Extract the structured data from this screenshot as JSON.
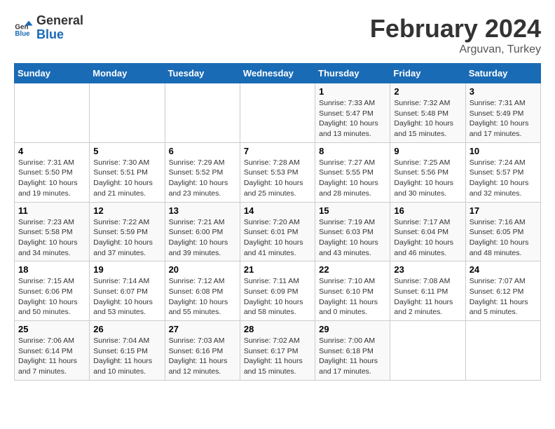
{
  "logo": {
    "general": "General",
    "blue": "Blue"
  },
  "title": "February 2024",
  "subtitle": "Arguvan, Turkey",
  "headers": [
    "Sunday",
    "Monday",
    "Tuesday",
    "Wednesday",
    "Thursday",
    "Friday",
    "Saturday"
  ],
  "weeks": [
    [
      {
        "day": "",
        "info": ""
      },
      {
        "day": "",
        "info": ""
      },
      {
        "day": "",
        "info": ""
      },
      {
        "day": "",
        "info": ""
      },
      {
        "day": "1",
        "info": "Sunrise: 7:33 AM\nSunset: 5:47 PM\nDaylight: 10 hours\nand 13 minutes."
      },
      {
        "day": "2",
        "info": "Sunrise: 7:32 AM\nSunset: 5:48 PM\nDaylight: 10 hours\nand 15 minutes."
      },
      {
        "day": "3",
        "info": "Sunrise: 7:31 AM\nSunset: 5:49 PM\nDaylight: 10 hours\nand 17 minutes."
      }
    ],
    [
      {
        "day": "4",
        "info": "Sunrise: 7:31 AM\nSunset: 5:50 PM\nDaylight: 10 hours\nand 19 minutes."
      },
      {
        "day": "5",
        "info": "Sunrise: 7:30 AM\nSunset: 5:51 PM\nDaylight: 10 hours\nand 21 minutes."
      },
      {
        "day": "6",
        "info": "Sunrise: 7:29 AM\nSunset: 5:52 PM\nDaylight: 10 hours\nand 23 minutes."
      },
      {
        "day": "7",
        "info": "Sunrise: 7:28 AM\nSunset: 5:53 PM\nDaylight: 10 hours\nand 25 minutes."
      },
      {
        "day": "8",
        "info": "Sunrise: 7:27 AM\nSunset: 5:55 PM\nDaylight: 10 hours\nand 28 minutes."
      },
      {
        "day": "9",
        "info": "Sunrise: 7:25 AM\nSunset: 5:56 PM\nDaylight: 10 hours\nand 30 minutes."
      },
      {
        "day": "10",
        "info": "Sunrise: 7:24 AM\nSunset: 5:57 PM\nDaylight: 10 hours\nand 32 minutes."
      }
    ],
    [
      {
        "day": "11",
        "info": "Sunrise: 7:23 AM\nSunset: 5:58 PM\nDaylight: 10 hours\nand 34 minutes."
      },
      {
        "day": "12",
        "info": "Sunrise: 7:22 AM\nSunset: 5:59 PM\nDaylight: 10 hours\nand 37 minutes."
      },
      {
        "day": "13",
        "info": "Sunrise: 7:21 AM\nSunset: 6:00 PM\nDaylight: 10 hours\nand 39 minutes."
      },
      {
        "day": "14",
        "info": "Sunrise: 7:20 AM\nSunset: 6:01 PM\nDaylight: 10 hours\nand 41 minutes."
      },
      {
        "day": "15",
        "info": "Sunrise: 7:19 AM\nSunset: 6:03 PM\nDaylight: 10 hours\nand 43 minutes."
      },
      {
        "day": "16",
        "info": "Sunrise: 7:17 AM\nSunset: 6:04 PM\nDaylight: 10 hours\nand 46 minutes."
      },
      {
        "day": "17",
        "info": "Sunrise: 7:16 AM\nSunset: 6:05 PM\nDaylight: 10 hours\nand 48 minutes."
      }
    ],
    [
      {
        "day": "18",
        "info": "Sunrise: 7:15 AM\nSunset: 6:06 PM\nDaylight: 10 hours\nand 50 minutes."
      },
      {
        "day": "19",
        "info": "Sunrise: 7:14 AM\nSunset: 6:07 PM\nDaylight: 10 hours\nand 53 minutes."
      },
      {
        "day": "20",
        "info": "Sunrise: 7:12 AM\nSunset: 6:08 PM\nDaylight: 10 hours\nand 55 minutes."
      },
      {
        "day": "21",
        "info": "Sunrise: 7:11 AM\nSunset: 6:09 PM\nDaylight: 10 hours\nand 58 minutes."
      },
      {
        "day": "22",
        "info": "Sunrise: 7:10 AM\nSunset: 6:10 PM\nDaylight: 11 hours\nand 0 minutes."
      },
      {
        "day": "23",
        "info": "Sunrise: 7:08 AM\nSunset: 6:11 PM\nDaylight: 11 hours\nand 2 minutes."
      },
      {
        "day": "24",
        "info": "Sunrise: 7:07 AM\nSunset: 6:12 PM\nDaylight: 11 hours\nand 5 minutes."
      }
    ],
    [
      {
        "day": "25",
        "info": "Sunrise: 7:06 AM\nSunset: 6:14 PM\nDaylight: 11 hours\nand 7 minutes."
      },
      {
        "day": "26",
        "info": "Sunrise: 7:04 AM\nSunset: 6:15 PM\nDaylight: 11 hours\nand 10 minutes."
      },
      {
        "day": "27",
        "info": "Sunrise: 7:03 AM\nSunset: 6:16 PM\nDaylight: 11 hours\nand 12 minutes."
      },
      {
        "day": "28",
        "info": "Sunrise: 7:02 AM\nSunset: 6:17 PM\nDaylight: 11 hours\nand 15 minutes."
      },
      {
        "day": "29",
        "info": "Sunrise: 7:00 AM\nSunset: 6:18 PM\nDaylight: 11 hours\nand 17 minutes."
      },
      {
        "day": "",
        "info": ""
      },
      {
        "day": "",
        "info": ""
      }
    ]
  ]
}
